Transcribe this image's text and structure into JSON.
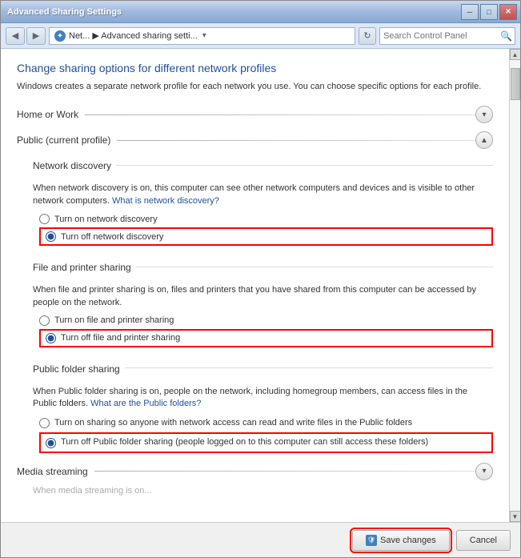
{
  "window": {
    "title": "Advanced Sharing Settings",
    "min_label": "─",
    "max_label": "□",
    "close_label": "✕"
  },
  "addressbar": {
    "back_icon": "◀",
    "forward_icon": "▶",
    "breadcrumb_icon": "✦",
    "path": "Net...  ▶  Advanced sharing setti...",
    "dropdown_icon": "▾",
    "refresh_icon": "↻",
    "search_placeholder": "Search Control Panel",
    "search_icon": "🔍"
  },
  "page": {
    "title": "Change sharing options for different network profiles",
    "subtitle": "Windows creates a separate network profile for each network you use. You can choose specific options for each profile.",
    "home_or_work": "Home or Work",
    "public_current": "Public (current profile)",
    "sections": {
      "network_discovery": {
        "title": "Network discovery",
        "description": "When network discovery is on, this computer can see other network computers and devices and is visible to other network computers.",
        "link": "What is network discovery?",
        "option1": "Turn on network discovery",
        "option2": "Turn off network discovery"
      },
      "file_printer": {
        "title": "File and printer sharing",
        "description": "When file and printer sharing is on, files and printers that you have shared from this computer can be accessed by people on the network.",
        "option1": "Turn on file and printer sharing",
        "option2": "Turn off file and printer sharing"
      },
      "public_folder": {
        "title": "Public folder sharing",
        "description": "When Public folder sharing is on, people on the network, including homegroup members, can access files in the Public folders.",
        "link": "What are the Public folders?",
        "option1": "Turn on sharing so anyone with network access can read and write files in the Public folders",
        "option2": "Turn off Public folder sharing (people logged on to this computer can still access these folders)"
      },
      "media_streaming": {
        "title": "Media streaming",
        "description": "When media streaming is on..."
      }
    }
  },
  "footer": {
    "save_label": "Save changes",
    "cancel_label": "Cancel"
  }
}
